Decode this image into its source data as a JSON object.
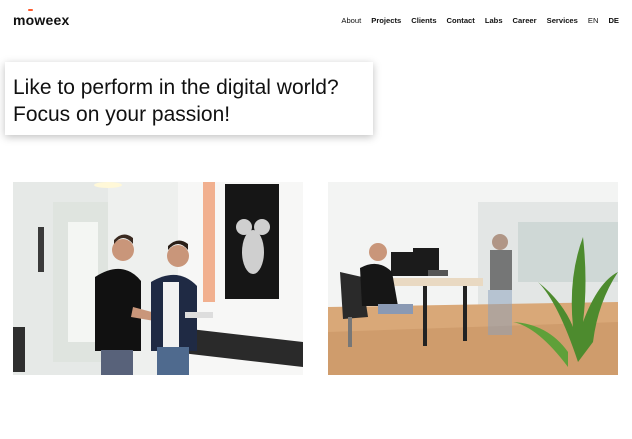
{
  "header": {
    "logo_text": "moweex",
    "nav": [
      {
        "label": "About",
        "active": true
      },
      {
        "label": "Projects"
      },
      {
        "label": "Clients"
      },
      {
        "label": "Contact"
      },
      {
        "label": "Labs"
      },
      {
        "label": "Career"
      },
      {
        "label": "Services"
      },
      {
        "label": "EN"
      },
      {
        "label": "DE"
      }
    ]
  },
  "hero": {
    "line1": "Like to perform in the digital world?",
    "line2": "Focus on your passion!"
  },
  "photos": {
    "left_alt": "two men at office reception",
    "right_alt": "people working in bright office"
  },
  "colors": {
    "accent": "#ff5a2c"
  }
}
